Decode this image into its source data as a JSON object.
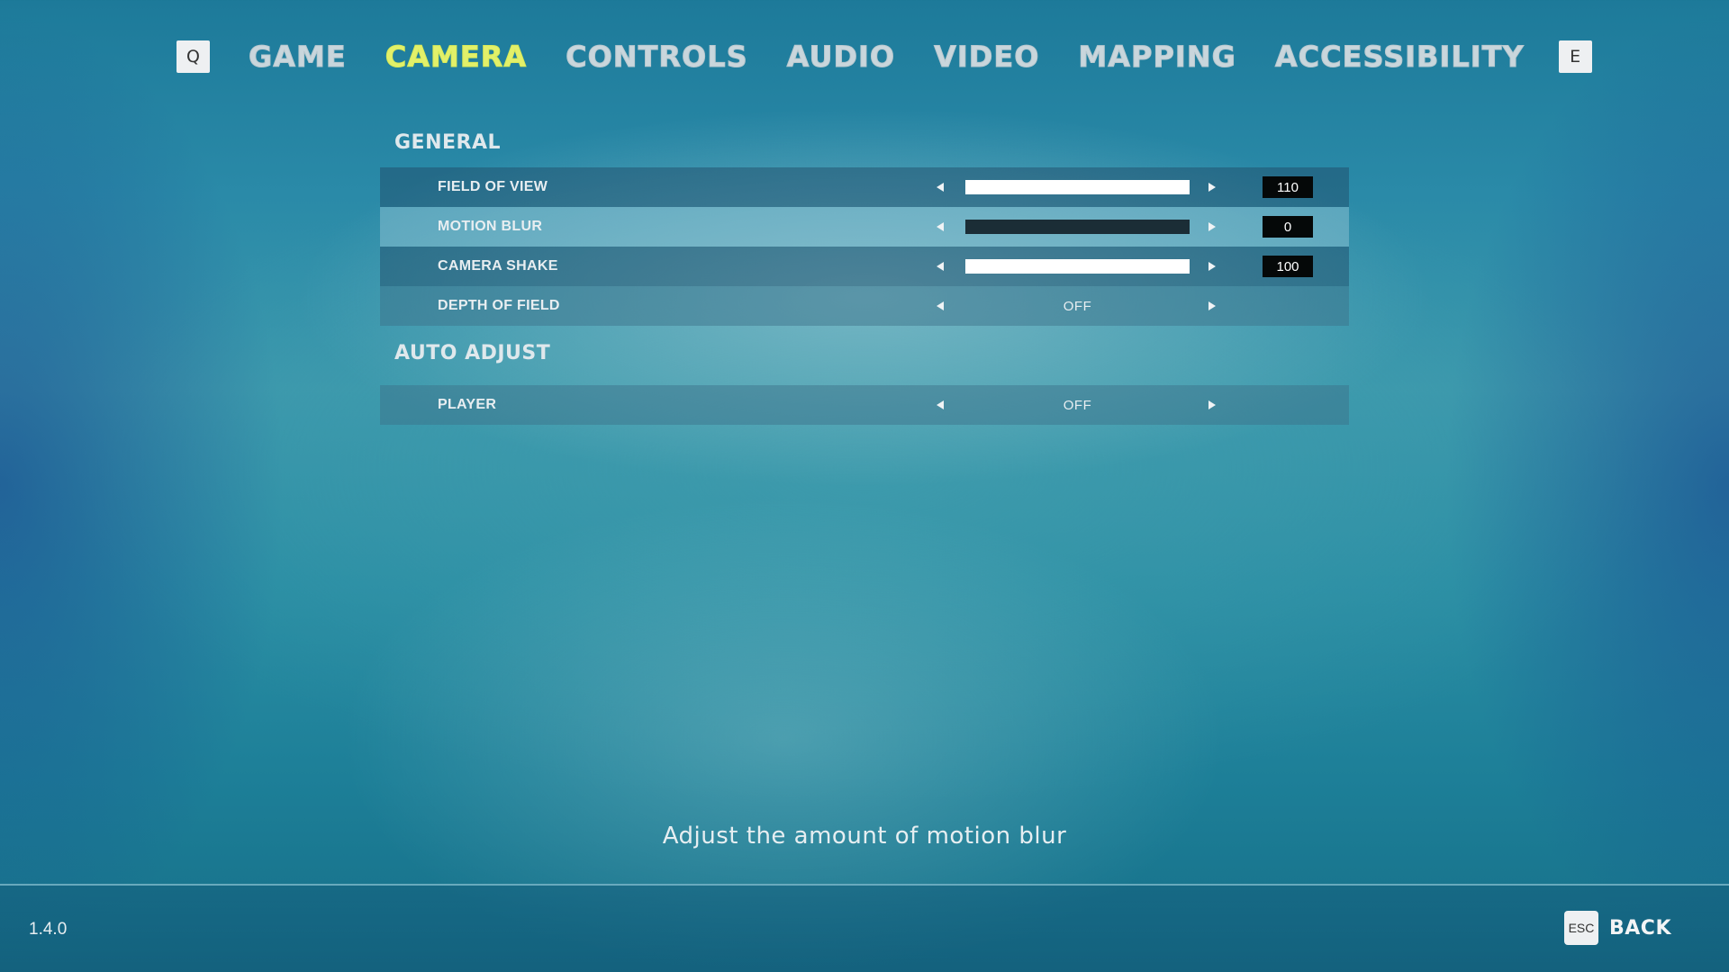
{
  "nav": {
    "prev_key": "Q",
    "next_key": "E",
    "tabs": [
      {
        "label": "GAME",
        "active": false
      },
      {
        "label": "CAMERA",
        "active": true
      },
      {
        "label": "CONTROLS",
        "active": false
      },
      {
        "label": "AUDIO",
        "active": false
      },
      {
        "label": "VIDEO",
        "active": false
      },
      {
        "label": "MAPPING",
        "active": false
      },
      {
        "label": "ACCESSIBILITY",
        "active": false
      }
    ]
  },
  "sections": [
    {
      "title": "GENERAL",
      "settings": [
        {
          "label": "FIELD OF VIEW",
          "type": "slider",
          "value": "110",
          "fill_fraction": 1.0
        },
        {
          "label": "MOTION BLUR",
          "type": "slider",
          "value": "0",
          "fill_fraction": 0.0,
          "selected": true
        },
        {
          "label": "CAMERA SHAKE",
          "type": "slider",
          "value": "100",
          "fill_fraction": 1.0
        },
        {
          "label": "DEPTH OF FIELD",
          "type": "option",
          "value": "OFF"
        }
      ]
    },
    {
      "title": "AUTO ADJUST",
      "settings": [
        {
          "label": "PLAYER",
          "type": "option",
          "value": "OFF"
        }
      ]
    }
  ],
  "description": "Adjust the amount of motion blur",
  "footer": {
    "version": "1.4.0",
    "back_key": "ESC",
    "back_label": "BACK"
  },
  "colors": {
    "active_tab": "#e2f06a",
    "inactive_tab": "#c9d6dc"
  },
  "icons": [
    "arrow-left-icon",
    "arrow-right-icon"
  ]
}
